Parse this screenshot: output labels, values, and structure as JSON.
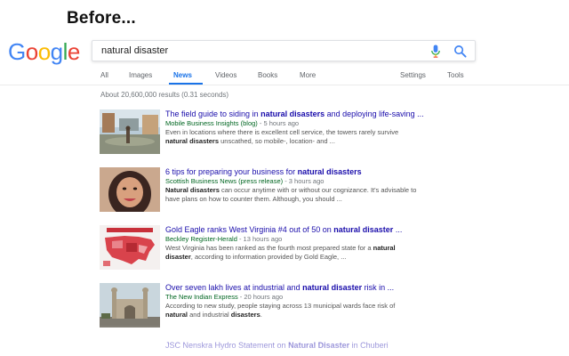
{
  "caption": "Before...",
  "logo": {
    "letters": [
      "G",
      "o",
      "o",
      "g",
      "l",
      "e"
    ],
    "colors": [
      "#4285F4",
      "#EA4335",
      "#FBBC05",
      "#4285F4",
      "#34A853",
      "#EA4335"
    ]
  },
  "search": {
    "query": "natural disaster"
  },
  "tabs": [
    {
      "label": "All"
    },
    {
      "label": "Images"
    },
    {
      "label": "News",
      "active": true
    },
    {
      "label": "Videos"
    },
    {
      "label": "Books"
    },
    {
      "label": "More"
    },
    {
      "label": "Settings"
    },
    {
      "label": "Tools"
    }
  ],
  "result_stats": "About 20,600,000 results (0.31 seconds)",
  "results": [
    {
      "title_pre": "The field guide to siding in ",
      "title_bold": "natural disasters",
      "title_post": " and deploying life-saving ...",
      "source": "Mobile Business Insights (blog)",
      "time": " - 5 hours ago",
      "snippet_1": "Even in locations where there is excellent cell service, the towers rarely survive",
      "snippet_2_bold": "natural disasters",
      "snippet_2": " unscathed, so mobile-, location- and ..."
    },
    {
      "title_pre": "6 tips for preparing your business for ",
      "title_bold": "natural disasters",
      "title_post": "",
      "source": "Scottish Business News (press release)",
      "time": " - 3 hours ago",
      "snippet_1_bold": "Natural disasters",
      "snippet_1": " can occur anytime with or without our cognizance. It's advisable to",
      "snippet_2": "have plans on how to counter them. Although, you should ..."
    },
    {
      "title_pre": "Gold Eagle ranks West Virginia #4 out of 50 on ",
      "title_bold": "natural disaster",
      "title_post": " ...",
      "source": "Beckley Register-Herald",
      "time": " - 13 hours ago",
      "snippet_1": "West Virginia has been ranked as the fourth most prepared state for a ",
      "snippet_1_bold": "natural",
      "snippet_2_bold": "disaster",
      "snippet_2": ", according to information provided by Gold Eagle, ..."
    },
    {
      "title_pre": "Over seven lakh lives at industrial and ",
      "title_bold": "natural disaster",
      "title_post": " risk in ...",
      "source": "The New Indian Express",
      "time": " - 20 hours ago",
      "snippet_1": "According to new study, people staying across 13 municipal wards face risk of",
      "snippet_2_bold": "natural",
      "snippet_2_mid": " and industrial ",
      "snippet_2_bold2": "disasters",
      "snippet_2": "."
    },
    {
      "title_pre": "JSC Nenskra Hydro Statement on ",
      "title_bold": "Natural Disaster",
      "title_post": " in Chuberi"
    }
  ]
}
